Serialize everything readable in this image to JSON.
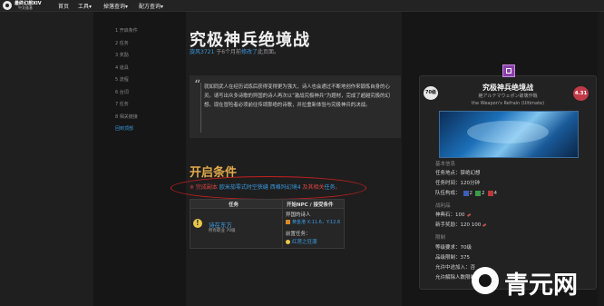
{
  "header": {
    "logo_name": "最终幻想XIV",
    "logo_sub": "中文维基",
    "nav": [
      "首页",
      "工具▾",
      "掉落查询▾",
      "配方查询▾"
    ]
  },
  "toc": [
    {
      "label": "1 开启条件",
      "active": false
    },
    {
      "label": "2 任务",
      "active": false
    },
    {
      "label": "3 奖励",
      "active": false
    },
    {
      "label": "4 道具",
      "active": false
    },
    {
      "label": "5 流程",
      "active": false
    },
    {
      "label": "6 台词",
      "active": false
    },
    {
      "label": "7 任务",
      "active": false
    },
    {
      "label": "8 相关链接",
      "active": false
    },
    {
      "label": "回到顶部",
      "active": true
    }
  ],
  "page": {
    "title": "究极神兵绝境战",
    "meta_user": "旋风3721",
    "meta_mid": " 于6个月前",
    "meta_action": "修改了",
    "meta_end": "此页面。"
  },
  "quote": {
    "text": "就如同武人在经历试炼后获得变得更为强大，诗人也会通过不断地创作来锻炼自身的心灵。请写出众多诗歌的异国的诗人再次以“激战究极神兵”为题材，完成了超越究极的幻想。现在冒险者必须前往传颂那绝的诗歌，并拉重新体验与究极神兵的决战。"
  },
  "section": {
    "title": "开启条件",
    "cond_prefix": "※ 完成副本 ",
    "cond_link1": "欧米茄零式时空狭缝 西格玛幻境4",
    "cond_mid": " 及其相关",
    "cond_link2": "任务",
    "cond_end": "。"
  },
  "table": {
    "col_quest": "任务",
    "col_npc": "开始NPC / 接受条件",
    "quest_name": "诗在东方",
    "quest_req": "所有职业 70级",
    "npc_name": "异国的诗人",
    "npc_loc": "黄金港 X:11.6，Y:12.8",
    "prev_label": "前置任务：",
    "prev_quest": "红莲之狂潮"
  },
  "duty": {
    "title": "究极神兵绝境战",
    "jp": "絶アルテマウェポン破壊作戦",
    "en": "the Weapon's Refrain (Ultimate)",
    "level": "70级",
    "item_level": "4.31",
    "sec_basic": "基本信息",
    "location_label": "任务地点：",
    "location": "禁绝幻想",
    "time_label": "任务时间：",
    "time": "120分钟",
    "party_label": "队伍构成：",
    "party_tank": "2",
    "party_heal": "2",
    "party_dps": "4",
    "sec_reward": "战利品",
    "tomestone_label": "神典石：",
    "tomestone": "100",
    "newbie_label": "新手奖励：",
    "newbie": "120 100",
    "sec_limit": "限制",
    "lvl_label": "等级要求：",
    "lvl": "70级",
    "ilvl_label": "品级限制：",
    "ilvl": "375",
    "join_label": "允许中途加入：",
    "join": "否",
    "unsync_label": "允许解除人数限制："
  },
  "watermark": "青元网",
  "colors": {
    "accent_link": "#3a9be0",
    "heading": "#e2a94a",
    "warn": "#d94444"
  }
}
